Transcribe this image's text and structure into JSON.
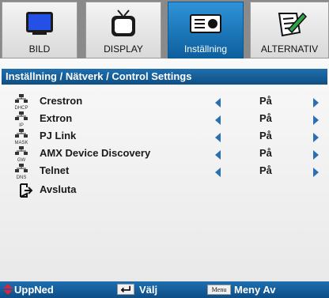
{
  "tabs": [
    {
      "label": "BILD",
      "icon": "monitor-icon",
      "active": false
    },
    {
      "label": "DISPLAY",
      "icon": "tv-icon",
      "active": false
    },
    {
      "label": "Inställning",
      "icon": "projector-icon",
      "active": true
    },
    {
      "label": "ALTERNATIV",
      "icon": "notepad-pen-icon",
      "active": false
    }
  ],
  "breadcrumb": "Inställning / Nätverk / Control Settings",
  "rows": [
    {
      "label": "Crestron",
      "icon_caption": "DHCP",
      "value": "På"
    },
    {
      "label": "Extron",
      "icon_caption": "IP",
      "value": "På"
    },
    {
      "label": "PJ Link",
      "icon_caption": "MASK",
      "value": "På"
    },
    {
      "label": "AMX Device Discovery",
      "icon_caption": "GW",
      "value": "På"
    },
    {
      "label": "Telnet",
      "icon_caption": "DNS",
      "value": "På"
    }
  ],
  "exit_label": "Avsluta",
  "footer": {
    "navigate": "UppNed",
    "select": "Välj",
    "menu_key": "Menu",
    "menu_off": "Meny Av"
  },
  "colors": {
    "accent": "#1166aa",
    "arrow": "#2a6fb0",
    "updown_icon": "#e0213a"
  }
}
